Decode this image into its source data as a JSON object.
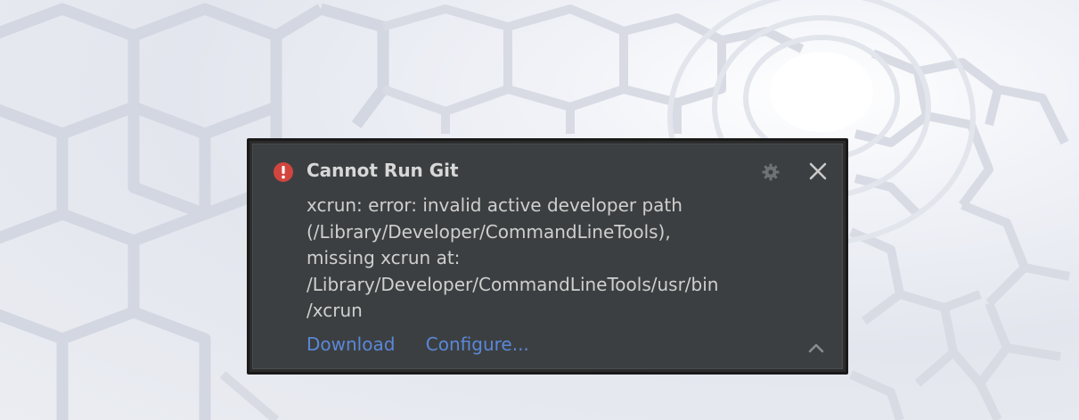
{
  "notification": {
    "title": "Cannot Run Git",
    "icon": "error-icon",
    "message_lines": [
      "xcrun: error: invalid active developer path",
      "(/Library/Developer/CommandLineTools),",
      "missing xcrun at:",
      "/Library/Developer/CommandLineTools/usr/bin",
      "/xcrun"
    ],
    "actions": {
      "download": "Download",
      "configure": "Configure..."
    }
  },
  "colors": {
    "panel_background": "#3c3f41",
    "error_red": "#d2453f",
    "link_blue": "#5a88d8",
    "title_text": "#d8d8d8",
    "body_text": "#cfcfcf"
  }
}
